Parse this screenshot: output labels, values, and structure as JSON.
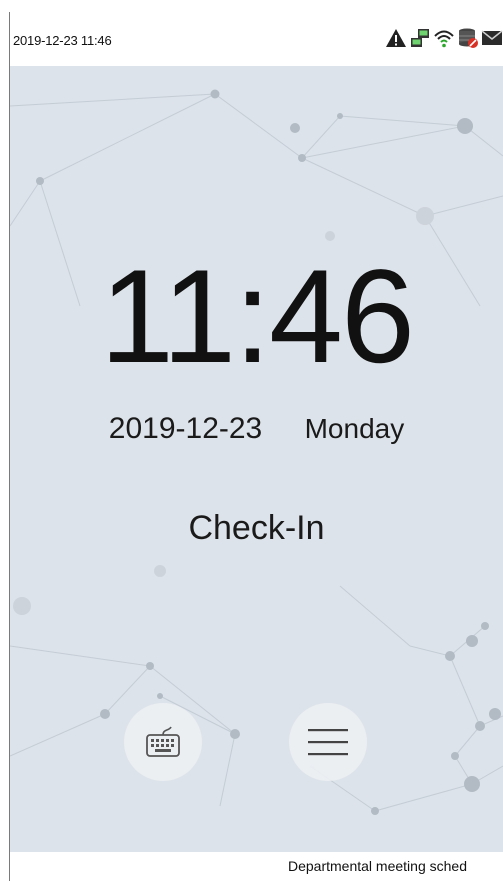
{
  "status_bar": {
    "datetime": "2019-12-23 11:46",
    "icons": [
      "alert-icon",
      "network-icon",
      "wifi-icon",
      "database-icon",
      "mail-icon"
    ]
  },
  "clock": {
    "time": "11:46",
    "date": "2019-12-23",
    "weekday": "Monday"
  },
  "attendance": {
    "state": "Check-In"
  },
  "bottom_buttons": [
    {
      "icon": "keyboard-icon"
    },
    {
      "icon": "menu-icon"
    }
  ],
  "ticker": {
    "text": "Departmental meeting sched"
  },
  "colors": {
    "background": "#dde3ea",
    "text": "#111111",
    "status_bar": "#ffffff",
    "alert_badge": "#d93025"
  }
}
